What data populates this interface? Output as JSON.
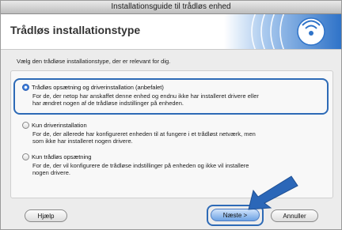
{
  "window": {
    "title": "Installationsguide til trådløs enhed"
  },
  "header": {
    "title": "Trådløs installationstype"
  },
  "instruction": "Vælg den trådløse installationstype, der er relevant for dig.",
  "options": [
    {
      "label": "Trådløs opsætning og driverinstallation (anbefalet)",
      "desc_lines": [
        "For de, der netop har anskaffet denne enhed og endnu ikke har installeret drivere eller",
        "har ændret nogen af de trådløse indstillinger på enheden."
      ],
      "selected": true
    },
    {
      "label": "Kun driverinstallation",
      "desc_lines": [
        "For de, der allerede har konfigureret enheden til at fungere i et trådløst netværk, men",
        "som ikke har installeret nogen drivere."
      ],
      "selected": false
    },
    {
      "label": "Kun trådløs opsætning",
      "desc_lines": [
        "For de, der vil konfigurere de trådløse indstillinger på enheden og ikke vil installere",
        "nogen drivere."
      ],
      "selected": false
    }
  ],
  "buttons": {
    "help": "Hjælp",
    "next": "Næste >",
    "cancel": "Annuller"
  },
  "colors": {
    "accent": "#2d6ab6",
    "header_logo": "#3a7fd0"
  },
  "icons": {
    "logo": "wireless-signal-icon",
    "pointer": "pointer-arrow-icon"
  }
}
